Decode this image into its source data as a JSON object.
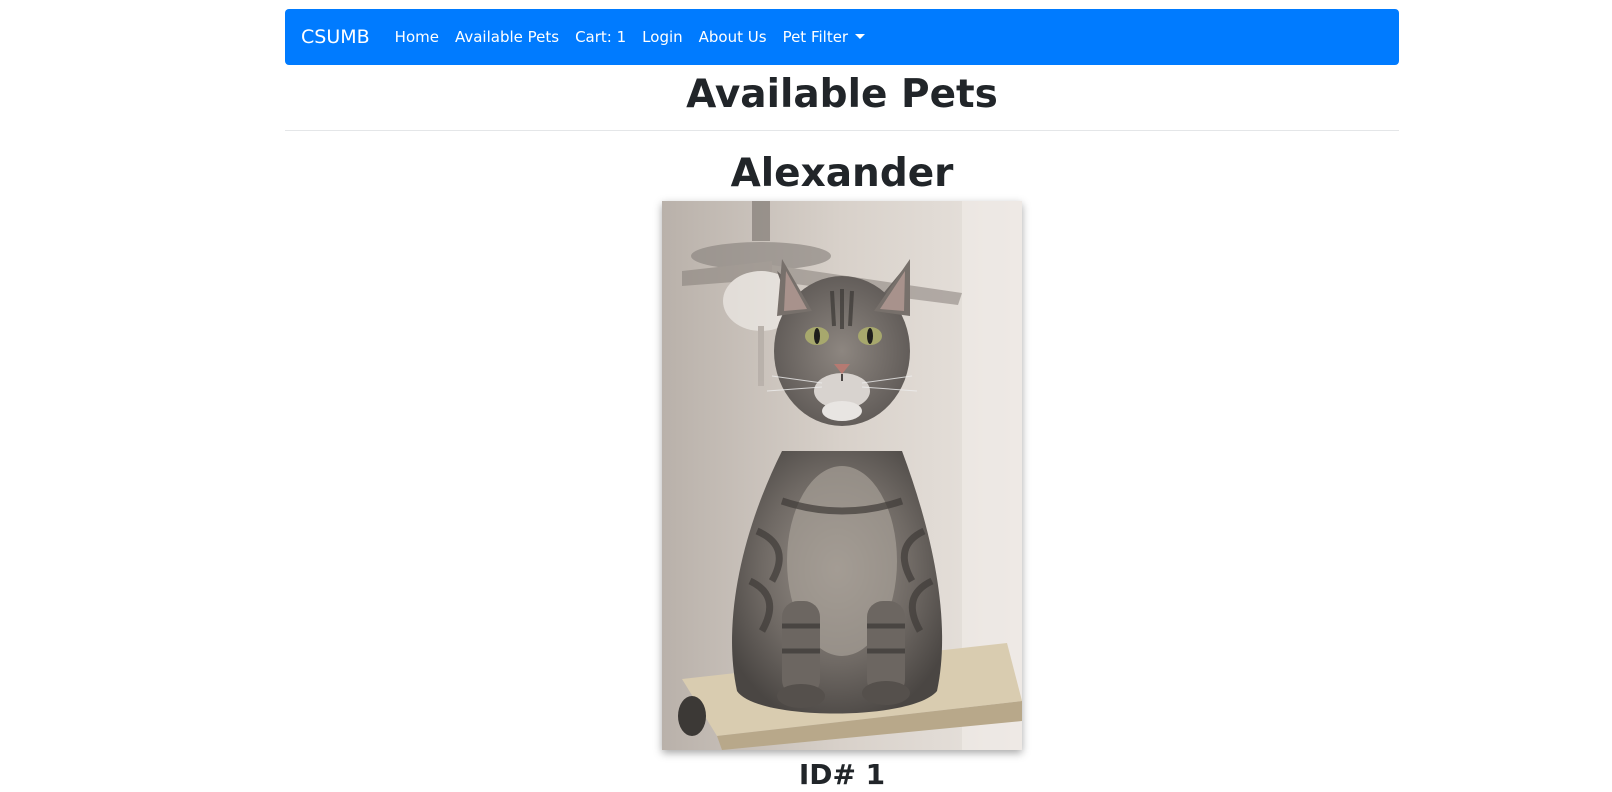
{
  "navbar": {
    "brand": "CSUMB",
    "items": [
      {
        "label": "Home"
      },
      {
        "label": "Available Pets"
      },
      {
        "label": "Cart: 1"
      },
      {
        "label": "Login"
      },
      {
        "label": "About Us"
      },
      {
        "label": "Pet Filter"
      }
    ],
    "bg_color": "#007bff"
  },
  "page": {
    "title": "Available Pets"
  },
  "pet": {
    "name": "Alexander",
    "id_label": "ID# 1",
    "photo_subject": "gray tabby cat sitting on scratching post"
  }
}
